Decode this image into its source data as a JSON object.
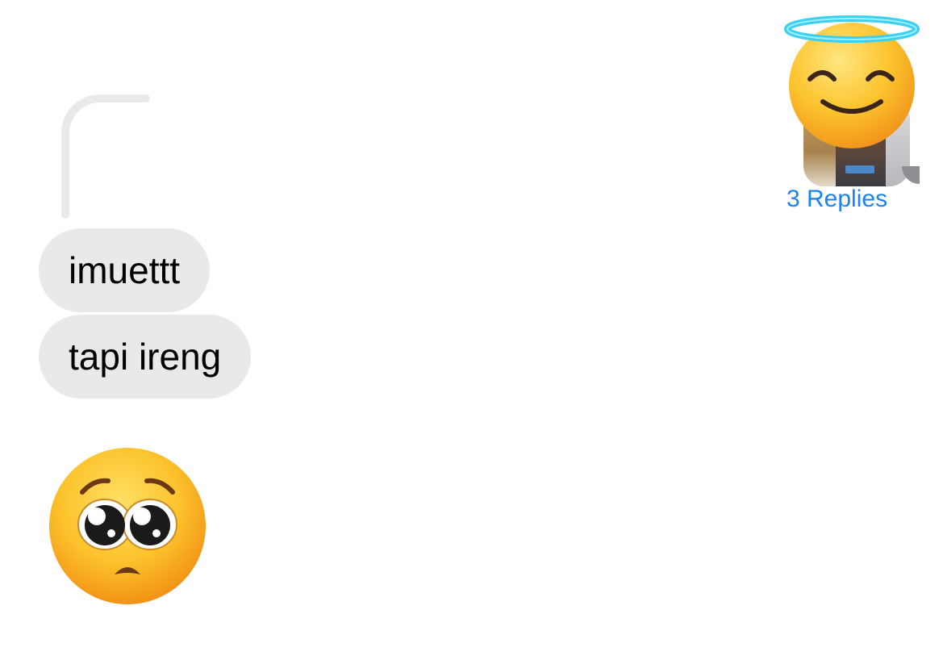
{
  "messages": [
    {
      "text": "imuettt"
    },
    {
      "text": "tapi ireng"
    }
  ],
  "emoji_message": {
    "icon": "pleading-face-icon",
    "glyph": "🥺"
  },
  "sticker": {
    "icon": "smiling-face-with-halo-icon"
  },
  "thread": {
    "replies_label": "3 Replies"
  },
  "colors": {
    "bubble_gray": "#e9e9eb",
    "link_blue": "#1a82f7",
    "halo_cyan": "#3cd0f0"
  }
}
